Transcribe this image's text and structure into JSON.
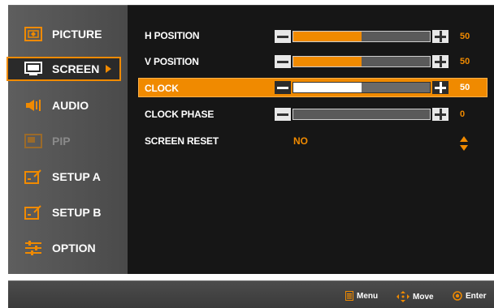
{
  "sidebar": {
    "items": [
      {
        "label": "PICTURE",
        "icon": "picture-icon"
      },
      {
        "label": "SCREEN",
        "icon": "screen-icon",
        "active": true
      },
      {
        "label": "AUDIO",
        "icon": "audio-icon"
      },
      {
        "label": "PIP",
        "icon": "pip-icon",
        "disabled": true
      },
      {
        "label": "SETUP A",
        "icon": "setup-a-icon"
      },
      {
        "label": "SETUP B",
        "icon": "setup-b-icon"
      },
      {
        "label": "OPTION",
        "icon": "option-icon"
      }
    ]
  },
  "settings": {
    "h_position": {
      "label": "H POSITION",
      "value": "50",
      "level": 0.5
    },
    "v_position": {
      "label": "V POSITION",
      "value": "50",
      "level": 0.5
    },
    "clock": {
      "label": "CLOCK",
      "value": "50",
      "level": 0.5,
      "selected": true
    },
    "clock_phase": {
      "label": "CLOCK PHASE",
      "value": "0",
      "level": 0.0
    },
    "screen_reset": {
      "label": "SCREEN RESET",
      "value": "NO"
    }
  },
  "footer": {
    "menu_label": "Menu",
    "move_label": "Move",
    "enter_label": "Enter"
  },
  "colors": {
    "accent": "#f08a00",
    "background": "#161616",
    "sidebar": "#555555"
  }
}
